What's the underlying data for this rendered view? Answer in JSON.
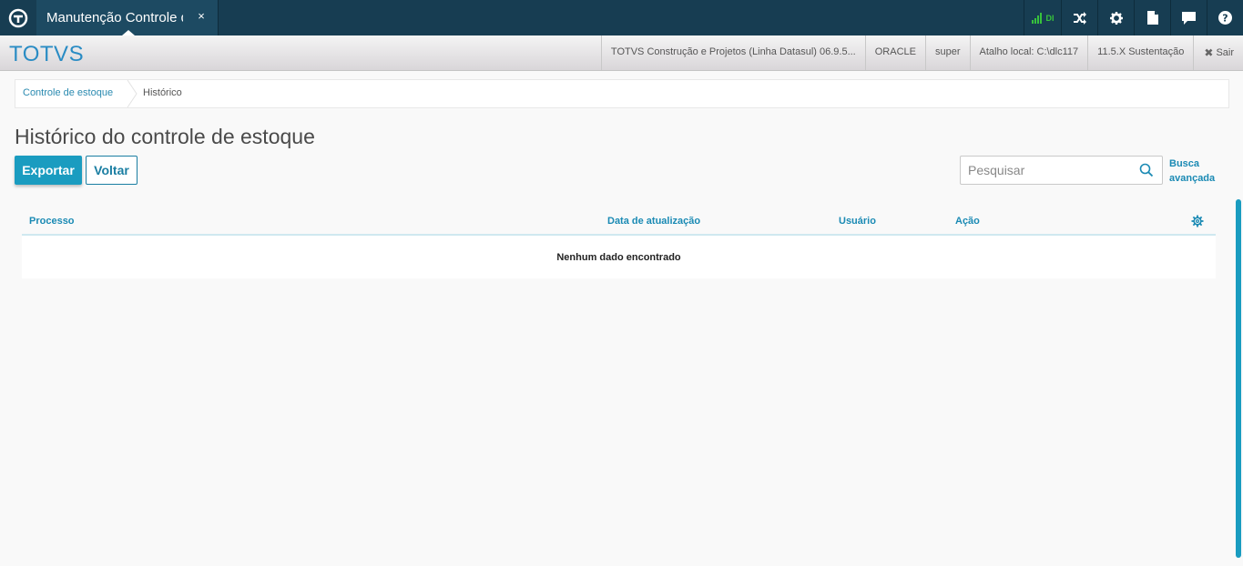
{
  "colors": {
    "topbar": "#173d52",
    "accent": "#1a9cc0",
    "link": "#2a8ab0",
    "brand": "#2a8cc4",
    "signal": "#37c23c"
  },
  "topbar": {
    "logo_icon": "totvs-logo-icon",
    "tab": {
      "label": "Manutenção Controle de Estoque",
      "close": "×"
    },
    "signal_label": "DI",
    "icons": [
      "signal-icon",
      "shuffle-icon",
      "gear-icon",
      "document-icon",
      "chat-icon",
      "help-icon"
    ]
  },
  "header": {
    "brand": "TOTVS",
    "product": "TOTVS Construção e Projetos (Linha Datasul) 06.9.5...",
    "database": "ORACLE",
    "user": "super",
    "shortcut": "Atalho local: C:\\dlc117",
    "version": "11.5.X Sustentação",
    "exit_label": "Sair"
  },
  "breadcrumb": {
    "items": [
      "Controle de estoque",
      "Histórico"
    ]
  },
  "page": {
    "title": "Histórico do controle de estoque",
    "export_label": "Exportar",
    "back_label": "Voltar"
  },
  "search": {
    "placeholder": "Pesquisar",
    "value": "",
    "advanced_line1": "Busca",
    "advanced_line2": "avançada"
  },
  "table": {
    "columns": [
      "Processo",
      "Data de atualização",
      "Usuário",
      "Ação"
    ],
    "rows": [],
    "empty_message": "Nenhum dado encontrado"
  }
}
